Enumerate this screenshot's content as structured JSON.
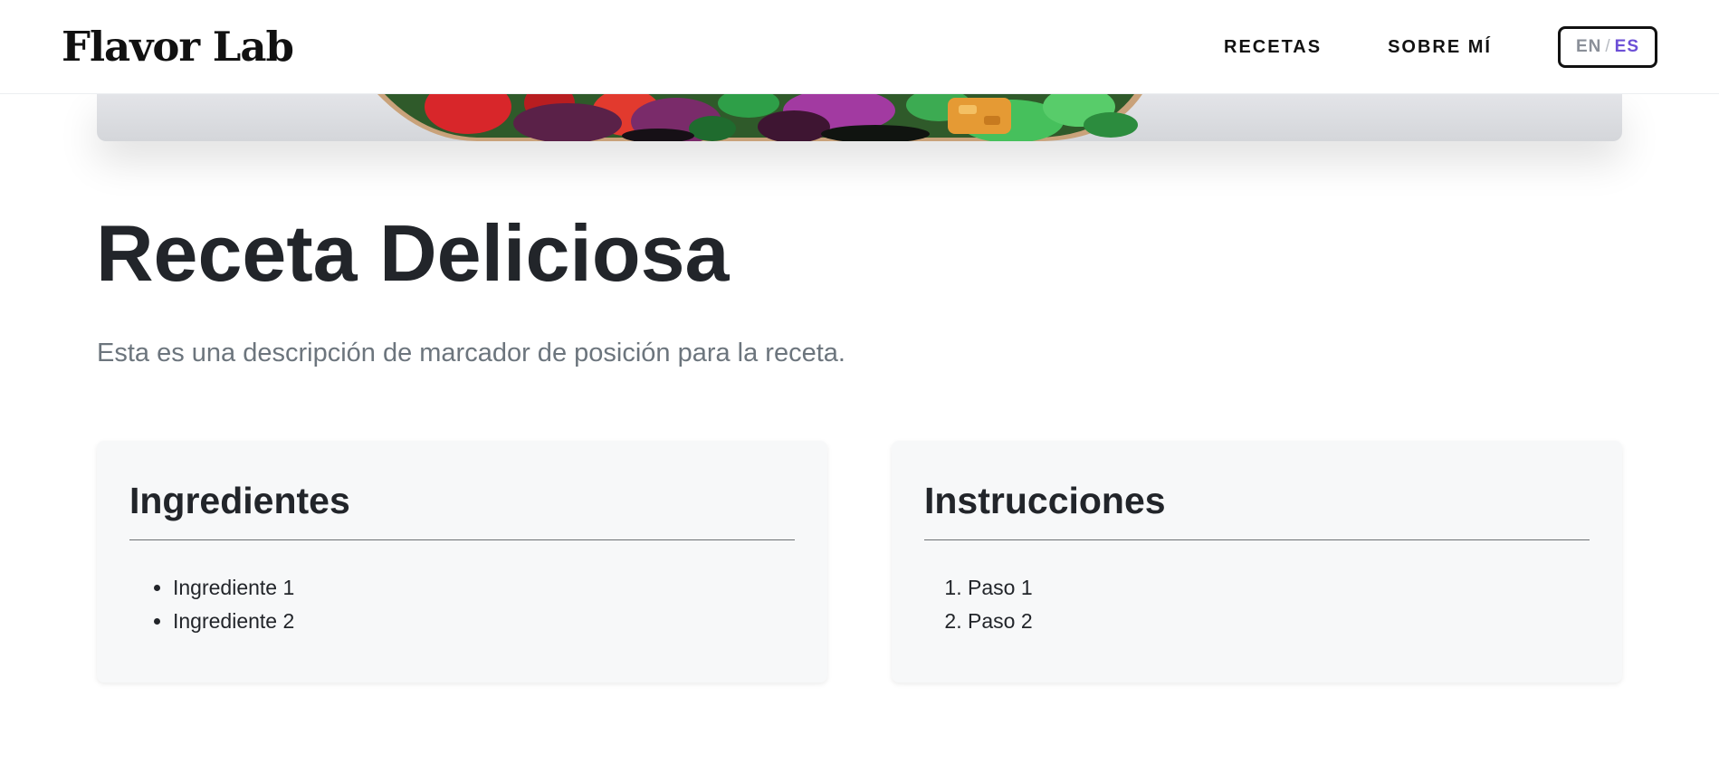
{
  "header": {
    "logo": "Flavor Lab",
    "nav": [
      {
        "label": "RECETAS"
      },
      {
        "label": "SOBRE MÍ"
      }
    ],
    "language": {
      "en": "EN",
      "separator": "/",
      "es": "ES",
      "active": "ES"
    }
  },
  "hero": {
    "image": "salad-bowl-photo"
  },
  "recipe": {
    "title": "Receta Deliciosa",
    "description": "Esta es una descripción de marcador de posición para la receta."
  },
  "ingredients": {
    "title": "Ingredientes",
    "items": [
      "Ingrediente 1",
      "Ingrediente 2"
    ]
  },
  "instructions": {
    "title": "Instrucciones",
    "items": [
      "Paso 1",
      "Paso 2"
    ]
  },
  "colors": {
    "accent": "#6c4fd6",
    "text": "#22252a",
    "muted": "#6c757d",
    "card_bg": "#f7f8f9"
  }
}
